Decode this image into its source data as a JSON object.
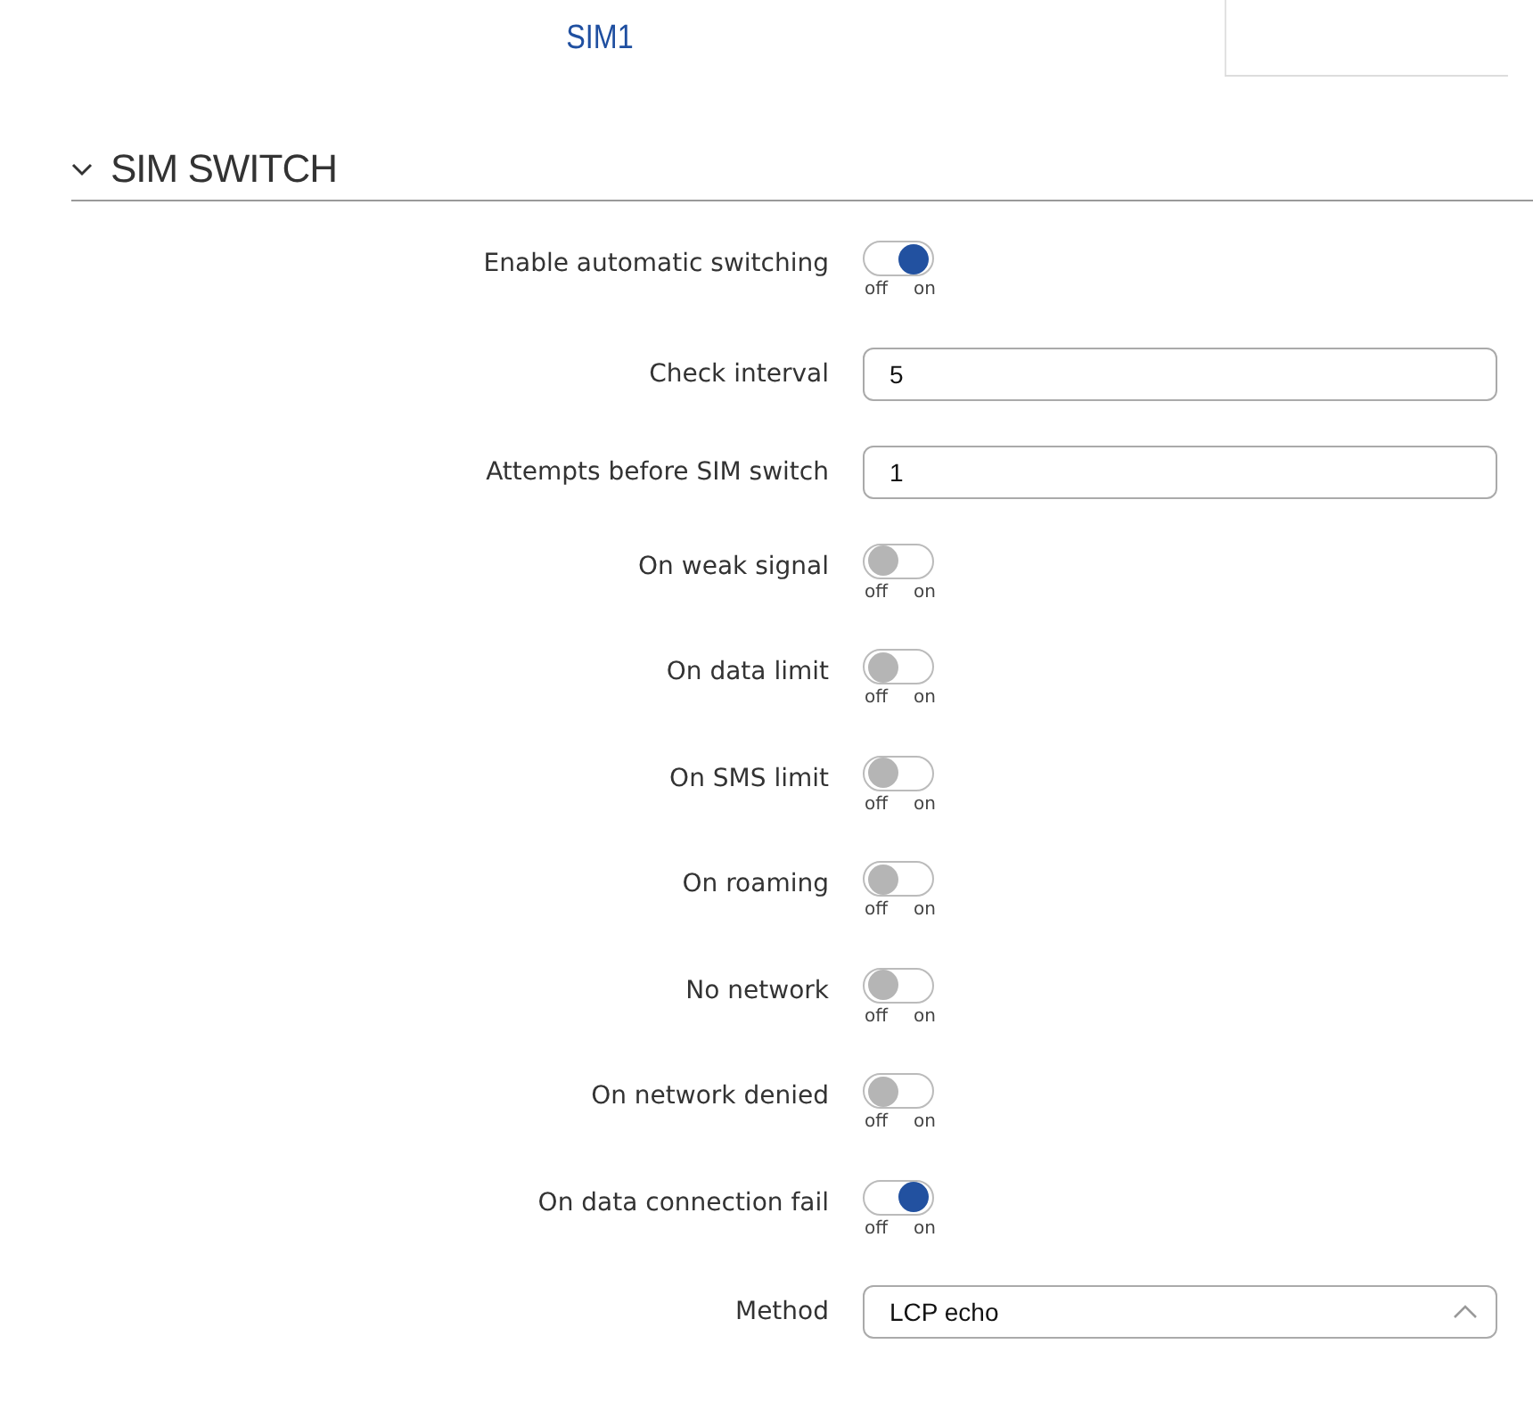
{
  "tabs": [
    {
      "label": "SIM1",
      "selected": true
    },
    {
      "selected": false
    }
  ],
  "section": {
    "title": "SIM SWITCH",
    "expanded": true
  },
  "fields": [
    {
      "kind": "toggle",
      "label": "Enable automatic switching",
      "on": true,
      "off_text": "off",
      "on_text": "on"
    },
    {
      "kind": "input",
      "label": "Check interval",
      "value": "5"
    },
    {
      "kind": "input",
      "label": "Attempts before SIM switch",
      "value": "1"
    },
    {
      "kind": "toggle",
      "label": "On weak signal",
      "on": false,
      "off_text": "off",
      "on_text": "on"
    },
    {
      "kind": "toggle",
      "label": "On data limit",
      "on": false,
      "off_text": "off",
      "on_text": "on"
    },
    {
      "kind": "toggle",
      "label": "On SMS limit",
      "on": false,
      "off_text": "off",
      "on_text": "on"
    },
    {
      "kind": "toggle",
      "label": "On roaming",
      "on": false,
      "off_text": "off",
      "on_text": "on"
    },
    {
      "kind": "toggle",
      "label": "No network",
      "on": false,
      "off_text": "off",
      "on_text": "on"
    },
    {
      "kind": "toggle",
      "label": "On network denied",
      "on": false,
      "off_text": "off",
      "on_text": "on"
    },
    {
      "kind": "toggle",
      "label": "On data connection fail",
      "on": true,
      "off_text": "off",
      "on_text": "on"
    },
    {
      "kind": "select",
      "label": "Method",
      "value": "LCP echo",
      "open": true
    }
  ]
}
